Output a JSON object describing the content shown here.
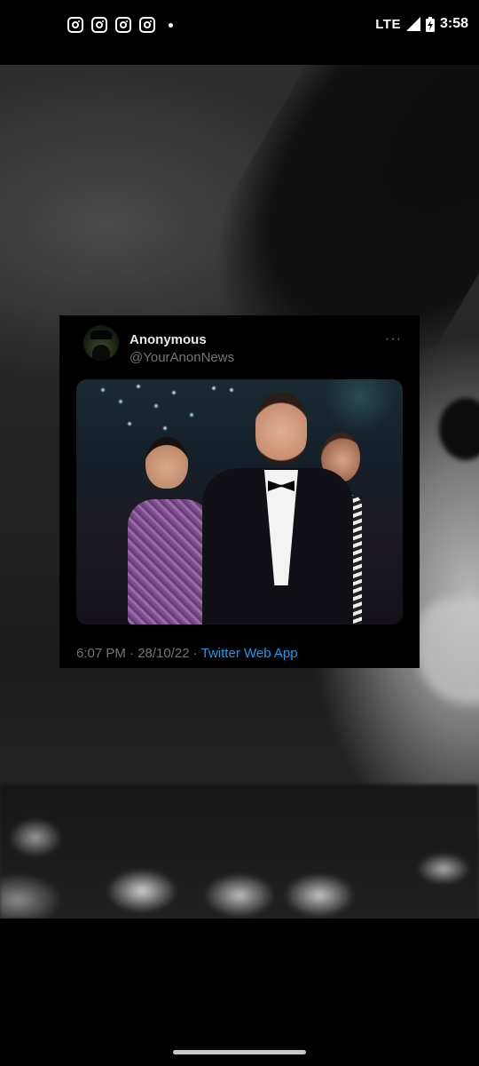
{
  "status_bar": {
    "network": "LTE",
    "time": "3:58",
    "notification_icons": [
      "instagram-icon",
      "instagram-icon",
      "instagram-icon",
      "instagram-icon"
    ]
  },
  "tweet": {
    "display_name": "Anonymous",
    "handle": "@YourAnonNews",
    "more_icon": "···",
    "time_date": "6:07 PM · 28/10/22 · ",
    "source": "Twitter Web App"
  },
  "colors": {
    "link": "#1d9bf0",
    "secondary_text": "#71767b",
    "primary_text": "#e7e9ea"
  }
}
